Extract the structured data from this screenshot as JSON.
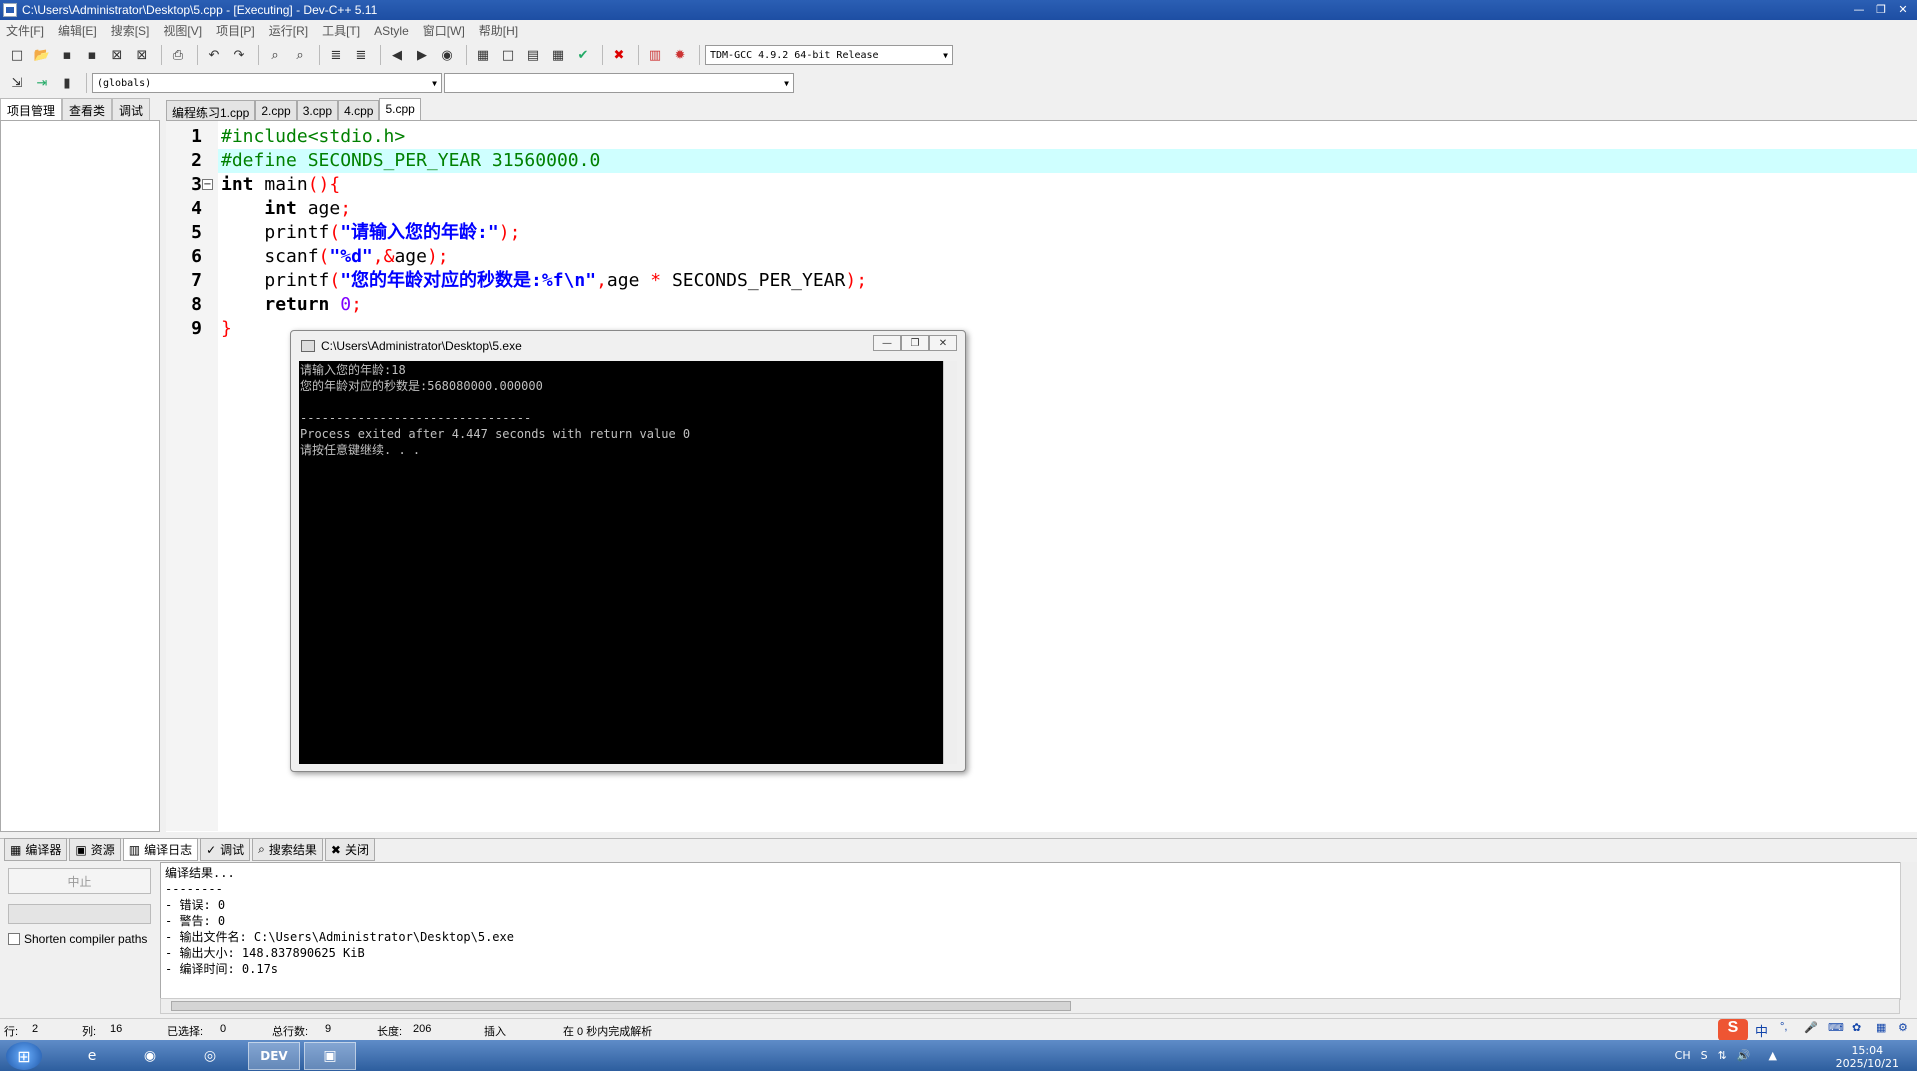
{
  "window": {
    "title": "C:\\Users\\Administrator\\Desktop\\5.cpp - [Executing] - Dev-C++ 5.11",
    "buttons": [
      "—",
      "❐",
      "✕"
    ]
  },
  "menu": [
    "文件[F]",
    "编辑[E]",
    "搜索[S]",
    "视图[V]",
    "项目[P]",
    "运行[R]",
    "工具[T]",
    "AStyle",
    "窗口[W]",
    "帮助[H]"
  ],
  "toolbar": {
    "compiler": "TDM-GCC 4.9.2 64-bit Release",
    "scope": "(globals)",
    "symbol": ""
  },
  "left_tabs": [
    "项目管理",
    "查看类",
    "调试"
  ],
  "editor_tabs": [
    "编程练习1.cpp",
    "2.cpp",
    "3.cpp",
    "4.cpp",
    "5.cpp"
  ],
  "code_lines": [
    {
      "n": "1",
      "parts": [
        [
          "pp",
          "#include<stdio.h>"
        ]
      ]
    },
    {
      "n": "2",
      "parts": [
        [
          "pp",
          "#define SECONDS_PER_YEAR 31560000.0"
        ]
      ]
    },
    {
      "n": "3",
      "parts": [
        [
          "kw",
          "int"
        ],
        [
          "",
          " main"
        ],
        [
          "op",
          "(){"
        ]
      ]
    },
    {
      "n": "4",
      "parts": [
        [
          "",
          "    "
        ],
        [
          "kw",
          "int"
        ],
        [
          "",
          " age"
        ],
        [
          "op",
          ";"
        ]
      ]
    },
    {
      "n": "5",
      "parts": [
        [
          "",
          "    printf"
        ],
        [
          "op",
          "("
        ],
        [
          "str",
          "\"请输入您的年龄:\""
        ],
        [
          "op",
          ");"
        ]
      ]
    },
    {
      "n": "6",
      "parts": [
        [
          "",
          "    scanf"
        ],
        [
          "op",
          "("
        ],
        [
          "str",
          "\"%d\""
        ],
        [
          "op",
          ",&"
        ],
        [
          "",
          "age"
        ],
        [
          "op",
          ");"
        ]
      ]
    },
    {
      "n": "7",
      "parts": [
        [
          "",
          "    printf"
        ],
        [
          "op",
          "("
        ],
        [
          "str",
          "\"您的年龄对应的秒数是:%f\\n\""
        ],
        [
          "op",
          ","
        ],
        [
          "",
          "age "
        ],
        [
          "op",
          "*"
        ],
        [
          "",
          " SECONDS_PER_YEAR"
        ],
        [
          "op",
          ");"
        ]
      ]
    },
    {
      "n": "8",
      "parts": [
        [
          "",
          "    "
        ],
        [
          "kw",
          "return"
        ],
        [
          "",
          " "
        ],
        [
          "num",
          "0"
        ],
        [
          "op",
          ";"
        ]
      ]
    },
    {
      "n": "9",
      "parts": [
        [
          "op",
          "}"
        ]
      ]
    }
  ],
  "console": {
    "title": "C:\\Users\\Administrator\\Desktop\\5.exe",
    "buttons": [
      "—",
      "❐",
      "✕"
    ],
    "output": "请输入您的年龄:18\n您的年龄对应的秒数是:568080000.000000\n\n--------------------------------\nProcess exited after 4.447 seconds with return value 0\n请按任意键继续. . ."
  },
  "bottom_tabs": [
    {
      "icon": "▦",
      "label": "编译器"
    },
    {
      "icon": "▣",
      "label": "资源"
    },
    {
      "icon": "▥",
      "label": "编译日志"
    },
    {
      "icon": "✓",
      "label": "调试"
    },
    {
      "icon": "⌕",
      "label": "搜索结果"
    },
    {
      "icon": "✖",
      "label": "关闭"
    }
  ],
  "compile_panel": {
    "abort_label": "中止",
    "shorten_label": "Shorten compiler paths",
    "log": "编译结果...\n--------\n- 错误: 0\n- 警告: 0\n- 输出文件名: C:\\Users\\Administrator\\Desktop\\5.exe\n- 输出大小: 148.837890625 KiB\n- 编译时间: 0.17s"
  },
  "status": {
    "row_label": "行:",
    "row": "2",
    "col_label": "列:",
    "col": "16",
    "sel_label": "已选择:",
    "sel": "0",
    "lines_label": "总行数:",
    "lines": "9",
    "len_label": "长度:",
    "len": "206",
    "mode": "插入",
    "parse": "在 0 秒内完成解析"
  },
  "tray": {
    "lang": "CH",
    "ime": "中",
    "time": "15:04",
    "date": "2025/10/21"
  }
}
